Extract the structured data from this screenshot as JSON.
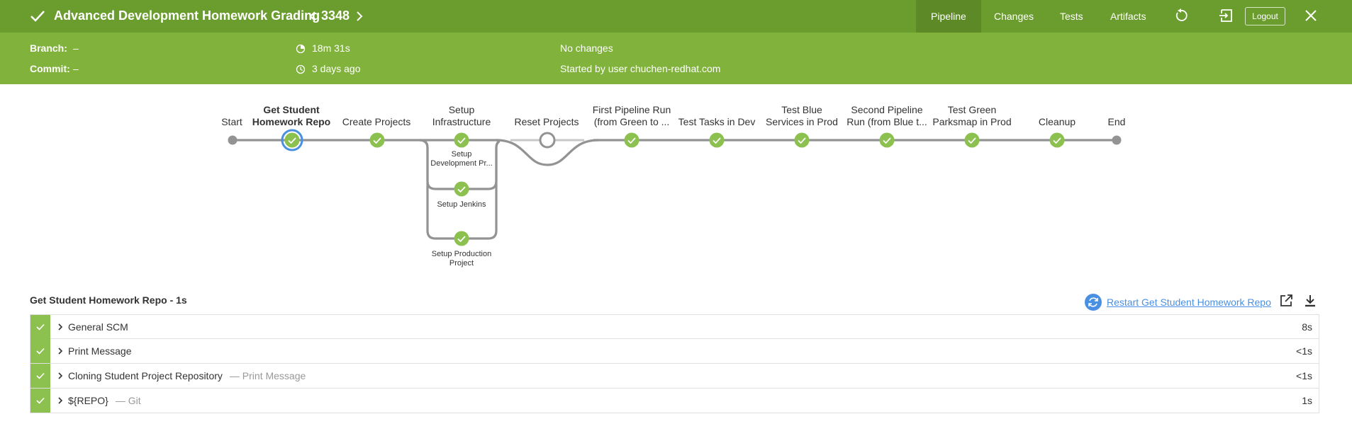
{
  "header": {
    "title": "Advanced Development Homework Grading",
    "run_number": "3348",
    "tabs": [
      "Pipeline",
      "Changes",
      "Tests",
      "Artifacts"
    ],
    "active_tab": "Pipeline",
    "logout_label": "Logout"
  },
  "summary": {
    "branch_label": "Branch:",
    "branch_value": "–",
    "commit_label": "Commit:",
    "commit_value": "–",
    "duration": "18m 31s",
    "time_ago": "3 days ago",
    "changes": "No changes",
    "started_by": "Started by user chuchen-redhat.com"
  },
  "pipeline": {
    "start_label": "Start",
    "end_label": "End",
    "stages": [
      {
        "label": "Get Student Homework Repo",
        "status": "success",
        "selected": true
      },
      {
        "label": "Create Projects",
        "status": "success"
      },
      {
        "label": "Setup Infrastructure",
        "status": "success"
      },
      {
        "label": "Reset Projects",
        "status": "skipped"
      },
      {
        "label": "First Pipeline Run (from Green to ...",
        "status": "success"
      },
      {
        "label": "Test Tasks in Dev",
        "status": "success"
      },
      {
        "label": "Test Blue Services in Prod",
        "status": "success"
      },
      {
        "label": "Second Pipeline Run (from Blue t...",
        "status": "success"
      },
      {
        "label": "Test Green Parksmap in Prod",
        "status": "success"
      },
      {
        "label": "Cleanup",
        "status": "success"
      }
    ],
    "parallel_branches": [
      {
        "label": "Setup Development Pr...",
        "status": "success"
      },
      {
        "label": "Setup Jenkins",
        "status": "success"
      },
      {
        "label": "Setup Production Project",
        "status": "success"
      }
    ]
  },
  "detail": {
    "title": "Get Student Homework Repo - 1s",
    "restart_label": "Restart Get Student Homework Repo",
    "steps": [
      {
        "name": "General SCM",
        "desc": "",
        "duration": "8s",
        "status": "success"
      },
      {
        "name": "Print Message",
        "desc": "",
        "duration": "<1s",
        "status": "success"
      },
      {
        "name": "Cloning Student Project Repository",
        "desc": "— Print Message",
        "duration": "<1s",
        "status": "success"
      },
      {
        "name": "${REPO}",
        "desc": "— Git",
        "duration": "1s",
        "status": "success"
      }
    ]
  },
  "colors": {
    "header_bg": "#6b9c2e",
    "subheader_bg": "#80b23c",
    "success": "#8cc04f",
    "link": "#4a90e2"
  },
  "icons": [
    "check-icon",
    "chevron-left-icon",
    "chevron-right-icon",
    "replay-icon",
    "exit-icon",
    "close-icon",
    "clock-icon",
    "duration-icon",
    "restart-icon",
    "open-external-icon",
    "download-icon",
    "expand-chevron-icon"
  ]
}
